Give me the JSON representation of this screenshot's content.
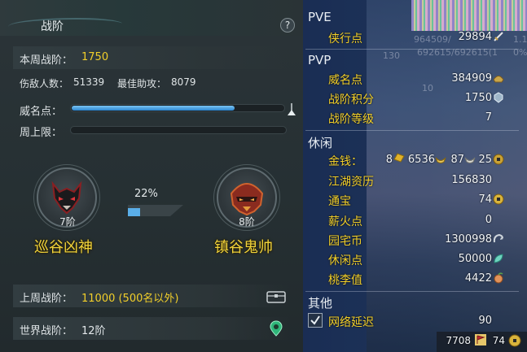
{
  "left": {
    "title": "战阶",
    "help": "?",
    "current_rank_label": "本周战阶：",
    "current_rank_value": "1750",
    "kills_label": "伤敌人数：",
    "kills_value": "51339",
    "best_assist_label": "最佳助攻：",
    "best_assist_value": "8079",
    "prestige_label": "威名点：",
    "prestige_progress": 0.77,
    "weekly_cap_label": "周上限：",
    "weekly_cap_progress": 0,
    "current_tier": {
      "level": "7阶",
      "name": "巡谷凶神"
    },
    "next_tier": {
      "level": "8阶",
      "name": "镇谷鬼帅"
    },
    "advance_percent": "22%",
    "advance_progress": 0.22,
    "last_week_label": "上周战阶：",
    "last_week_value": "11000 (500名以外)",
    "world_rank_label": "世界战阶：",
    "world_rank_value": "12阶"
  },
  "right": {
    "pve": {
      "title": "PVE",
      "items": [
        {
          "label": "侠行点",
          "value": "29894"
        }
      ]
    },
    "pvp": {
      "title": "PVP",
      "items": [
        {
          "label": "威名点",
          "value": "384909"
        },
        {
          "label": "战阶积分",
          "value": "1750"
        },
        {
          "label": "战阶等级",
          "value": "7"
        }
      ]
    },
    "leisure": {
      "title": "休闲",
      "money_label": "金钱：",
      "money_gold": "8",
      "money_silver": "6536",
      "money_copper": "87",
      "money_coin": "25",
      "items": [
        {
          "label": "江湖资历",
          "value": "156830"
        },
        {
          "label": "通宝",
          "value": "74"
        },
        {
          "label": "薪火点",
          "value": "0"
        },
        {
          "label": "园宅币",
          "value": "1300998"
        },
        {
          "label": "休闲点",
          "value": "50000"
        },
        {
          "label": "桃李值",
          "value": "4422"
        }
      ]
    },
    "other": {
      "title": "其他",
      "latency_label": "网络延迟",
      "latency_value": "90",
      "latency_checked": true
    },
    "footer": {
      "value_a": "7708",
      "value_b": "74"
    },
    "background_text": [
      "964509/",
      "692615/692615(1",
      "130",
      "10",
      "0%",
      "1.1"
    ]
  },
  "colors": {
    "accent_yellow": "#f2cf2a",
    "bar_blue": "#2c86d1",
    "panel_blue": "#1d3458"
  }
}
